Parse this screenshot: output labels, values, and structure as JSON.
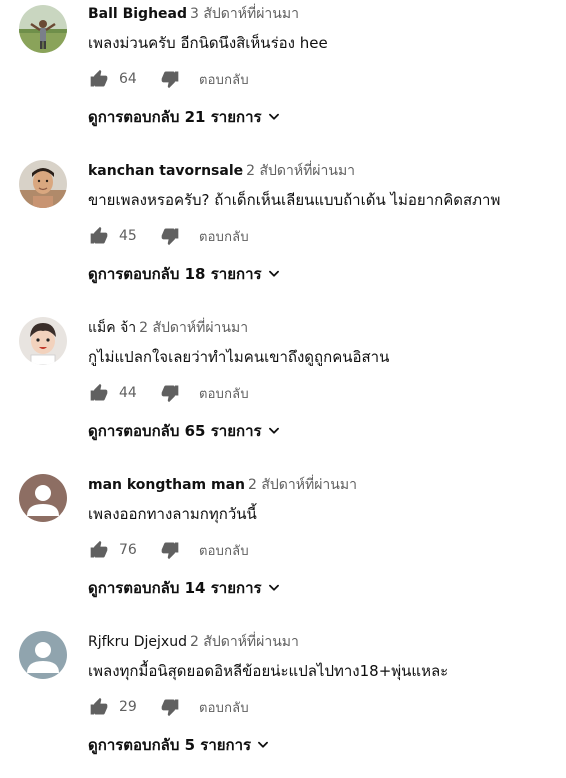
{
  "ui": {
    "reply_label": "ตอบกลับ",
    "replies_prefix": "ดูการตอบกลับ",
    "replies_suffix": "รายการ"
  },
  "colors": {
    "text": "#0f0f0f",
    "secondary_text": "#606060",
    "icon": "#606060",
    "avatar_gray": "#9aa0a6",
    "avatar_brown": "#8d6e63",
    "avatar_slate": "#90a4ae"
  },
  "comments": [
    {
      "author": "Ball Bighead",
      "time": "3 สัปดาห์ที่ผ่านมา",
      "text": "เพลงม่วนครับ อีกนิดนึงสิเห็นร่อง hee",
      "likes": "64",
      "replies": "21",
      "avatar_icon": "person-photo-avatar"
    },
    {
      "author": "kanchan tavornsale",
      "time": "2 สัปดาห์ที่ผ่านมา",
      "text": "ขายเพลงหรอครับ?  ถ้าเด็กเห็นเลียนแบบถ้าเด้น ไม่อยากคิดสภาพ",
      "likes": "45",
      "replies": "18",
      "avatar_icon": "person-photo-avatar"
    },
    {
      "author": "แม็ค จ้า",
      "time": "2 สัปดาห์ที่ผ่านมา",
      "text": "กูไม่แปลกใจเลยว่าทำไมคนเขาถึงดูถูกคนอิสาน",
      "likes": "44",
      "replies": "65",
      "avatar_icon": "person-cartoon-avatar"
    },
    {
      "author": "man kongtham man",
      "time": "2 สัปดาห์ที่ผ่านมา",
      "text": "เพลงออกทางลามกทุกวันนี้",
      "likes": "76",
      "replies": "14",
      "avatar_icon": "default-user-avatar"
    },
    {
      "author": "Rjfkru Djejxud",
      "time": "2 สัปดาห์ที่ผ่านมา",
      "text": "เพลงทุกมื้อนิสุดยอดอิหลีข้อยน่ะแปลไปทาง18+พุ่นแหละ",
      "likes": "29",
      "replies": "5",
      "avatar_icon": "default-user-avatar"
    }
  ]
}
